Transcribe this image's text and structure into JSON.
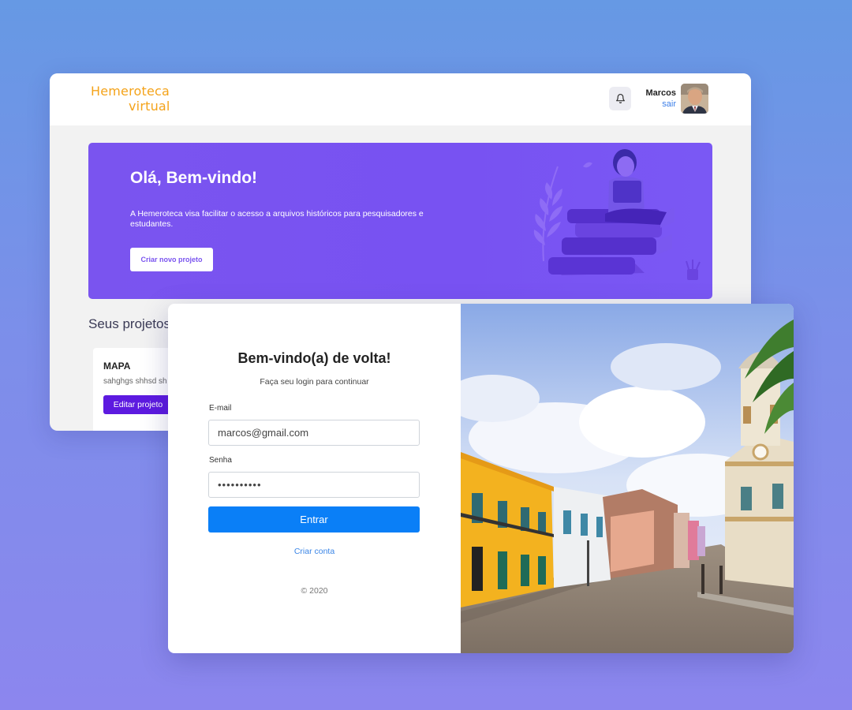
{
  "dashboard": {
    "logo": {
      "line1": "Hemeroteca",
      "line2": "virtual"
    },
    "user": {
      "name": "Marcos",
      "logout_label": "sair"
    },
    "banner": {
      "title": "Olá, Bem-vindo!",
      "text": "A Hemeroteca visa facilitar o acesso a arquivos históricos para pesquisadores e estudantes.",
      "button_label": "Criar novo projeto"
    },
    "projects": {
      "title": "Seus projetos",
      "items": [
        {
          "name": "MAPA",
          "description": "sahghgs shhsd sh",
          "button_label": "Editar projeto"
        }
      ]
    }
  },
  "login": {
    "title": "Bem-vindo(a) de volta!",
    "subtitle": "Faça seu login para continuar",
    "email_label": "E-mail",
    "email_value": "marcos@gmail.com",
    "password_label": "Senha",
    "password_value": "••••••••••",
    "submit_label": "Entrar",
    "create_account_label": "Criar conta",
    "copyright": "© 2020"
  },
  "colors": {
    "logo": "#f4a31a",
    "banner": "#7a54ef",
    "project_button": "#5d1ae0",
    "submit_button": "#0a7ff7",
    "link": "#3a85e6"
  },
  "icons": [
    "bell-icon"
  ]
}
